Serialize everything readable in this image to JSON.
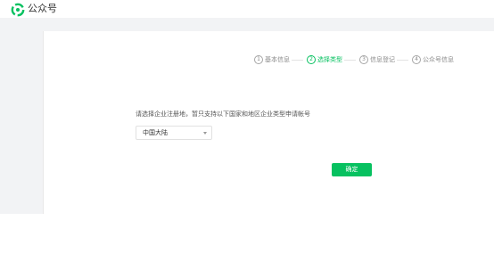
{
  "header": {
    "app_name": "公众号",
    "logo_icon": "wechat-official-accounts-logo-icon"
  },
  "steps": [
    {
      "number": "1",
      "label": "基本信息",
      "active": false
    },
    {
      "number": "2",
      "label": "选择类型",
      "active": true
    },
    {
      "number": "3",
      "label": "信息登记",
      "active": false
    },
    {
      "number": "4",
      "label": "公众号信息",
      "active": false
    }
  ],
  "form": {
    "prompt": "请选择企业注册地，暂只支持以下国家和地区企业类型申请帐号",
    "region_select": {
      "value": "中国大陆",
      "icon": "chevron-down-icon"
    },
    "confirm_label": "确定"
  },
  "colors": {
    "accent": "#07c160",
    "page_background": "#f2f3f5",
    "panel_background": "#ffffff"
  }
}
